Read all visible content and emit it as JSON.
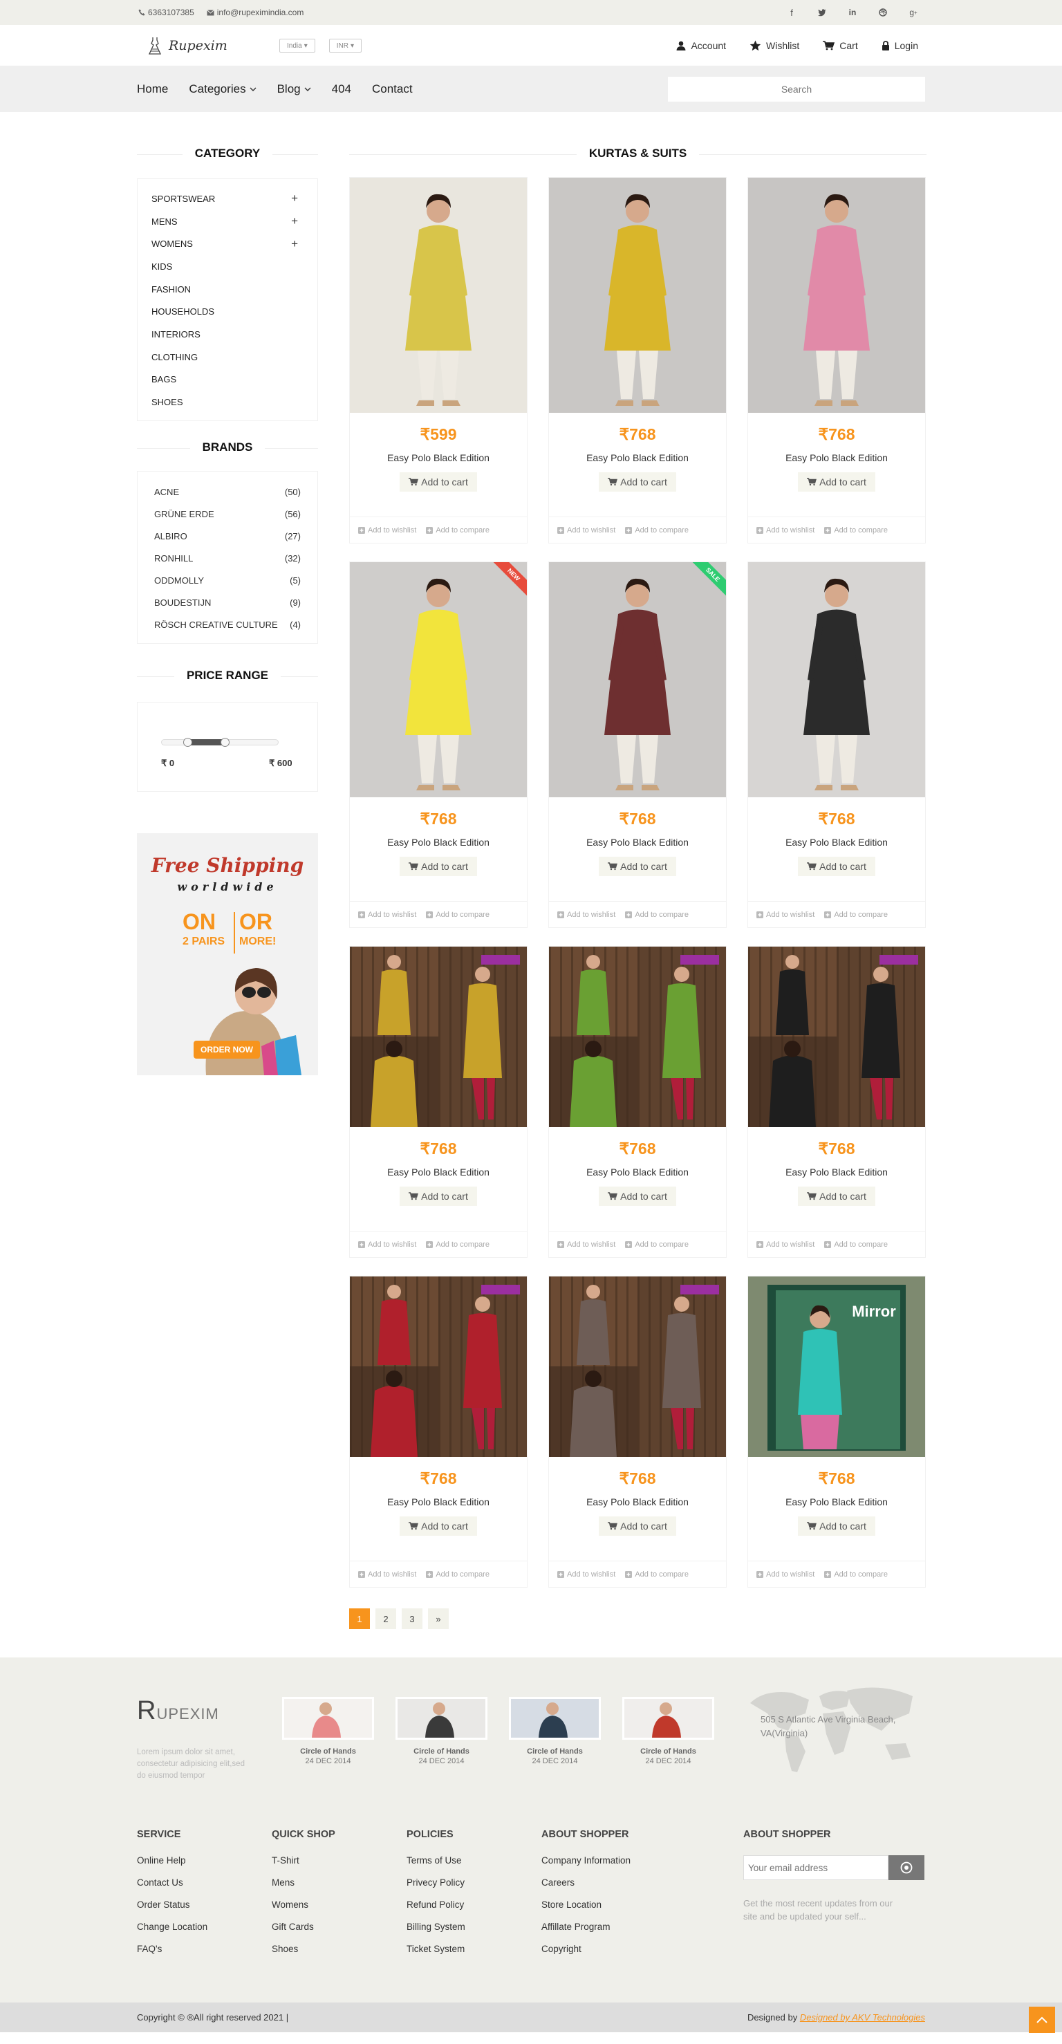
{
  "topbar": {
    "phone": "6363107385",
    "email": "info@rupeximindia.com",
    "social": [
      "facebook-icon",
      "twitter-icon",
      "linkedin-icon",
      "dribbble-icon",
      "google-plus-icon"
    ]
  },
  "header": {
    "brand": "Rupexim",
    "country": "India",
    "currency": "INR",
    "links": [
      "Account",
      "Wishlist",
      "Cart",
      "Login"
    ]
  },
  "nav": {
    "items": [
      "Home",
      "Categories",
      "Blog",
      "404",
      "Contact"
    ],
    "search_placeholder": "Search"
  },
  "sidebar": {
    "category_title": "CATEGORY",
    "categories": [
      {
        "label": "SPORTSWEAR",
        "expand": "+"
      },
      {
        "label": "MENS",
        "expand": "+"
      },
      {
        "label": "WOMENS",
        "expand": "+"
      },
      {
        "label": "KIDS",
        "expand": ""
      },
      {
        "label": "FASHION",
        "expand": ""
      },
      {
        "label": "HOUSEHOLDS",
        "expand": ""
      },
      {
        "label": "INTERIORS",
        "expand": ""
      },
      {
        "label": "CLOTHING",
        "expand": ""
      },
      {
        "label": "BAGS",
        "expand": ""
      },
      {
        "label": "SHOES",
        "expand": ""
      }
    ],
    "brands_title": "BRANDS",
    "brands": [
      {
        "label": "ACNE",
        "count": "(50)"
      },
      {
        "label": "GRÜNE ERDE",
        "count": "(56)"
      },
      {
        "label": "ALBIRO",
        "count": "(27)"
      },
      {
        "label": "RONHILL",
        "count": "(32)"
      },
      {
        "label": "ODDMOLLY",
        "count": "(5)"
      },
      {
        "label": "BOUDESTIJN",
        "count": "(9)"
      },
      {
        "label": "RÖSCH CREATIVE CULTURE",
        "count": "(4)"
      }
    ],
    "price_title": "PRICE RANGE",
    "price_min": "₹ 0",
    "price_max": "₹ 600",
    "promo": {
      "line1": "Free Shipping",
      "line2": "worldwide",
      "on": "ON",
      "or": "OR",
      "pairs": "2 PAIRS",
      "more": "MORE!",
      "cta": "ORDER NOW"
    }
  },
  "content": {
    "title": "KURTAS & SUITS",
    "add_to_cart": "Add to cart",
    "add_to_wishlist": "Add to wishlist",
    "add_to_compare": "Add to compare",
    "products": [
      {
        "price": "₹599",
        "name": "Easy Polo Black Edition",
        "color": "#d8c54a",
        "bg": "#e9e6de",
        "ribbon": ""
      },
      {
        "price": "₹768",
        "name": "Easy Polo Black Edition",
        "color": "#d9b62a",
        "bg": "#c9c7c5",
        "ribbon": ""
      },
      {
        "price": "₹768",
        "name": "Easy Polo Black Edition",
        "color": "#e18aa8",
        "bg": "#c7c5c3",
        "ribbon": ""
      },
      {
        "price": "₹768",
        "name": "Easy Polo Black Edition",
        "color": "#f2e43c",
        "bg": "#cfcdcb",
        "ribbon": "NEW"
      },
      {
        "price": "₹768",
        "name": "Easy Polo Black Edition",
        "color": "#6e2f30",
        "bg": "#cac8c6",
        "ribbon": "SALE"
      },
      {
        "price": "₹768",
        "name": "Easy Polo Black Edition",
        "color": "#2b2b2b",
        "bg": "#d7d5d3",
        "ribbon": ""
      },
      {
        "price": "₹768",
        "name": "Easy Polo Black Edition",
        "color": "#c8a22a",
        "bg": "#5a3e2a",
        "ribbon": ""
      },
      {
        "price": "₹768",
        "name": "Easy Polo Black Edition",
        "color": "#6aa033",
        "bg": "#5a3e2a",
        "ribbon": ""
      },
      {
        "price": "₹768",
        "name": "Easy Polo Black Edition",
        "color": "#1e1e1e",
        "bg": "#5a3e2a",
        "ribbon": ""
      },
      {
        "price": "₹768",
        "name": "Easy Polo Black Edition",
        "color": "#b0202c",
        "bg": "#5a3e2a",
        "ribbon": ""
      },
      {
        "price": "₹768",
        "name": "Easy Polo Black Edition",
        "color": "#6e5d56",
        "bg": "#5a3e2a",
        "ribbon": ""
      },
      {
        "price": "₹768",
        "name": "Easy Polo Black Edition",
        "color": "#2fc2b6",
        "bg": "#7e8a70",
        "ribbon": ""
      }
    ],
    "pages": [
      "1",
      "2",
      "3",
      "»"
    ]
  },
  "footer": {
    "logo_initial": "R",
    "logo_rest": "UPEXIM",
    "desc": "Lorem ipsum dolor sit amet, consectetur adipisicing elit,sed do eiusmod tempor",
    "posts": [
      {
        "title": "Circle of Hands",
        "date": "24 DEC 2014"
      },
      {
        "title": "Circle of Hands",
        "date": "24 DEC 2014"
      },
      {
        "title": "Circle of Hands",
        "date": "24 DEC 2014"
      },
      {
        "title": "Circle of Hands",
        "date": "24 DEC 2014"
      }
    ],
    "address": "505 S Atlantic Ave Virginia Beach, VA(Virginia)",
    "columns": [
      {
        "title": "SERVICE",
        "links": [
          "Online Help",
          "Contact Us",
          "Order Status",
          "Change Location",
          "FAQ's"
        ]
      },
      {
        "title": "QUICK SHOP",
        "links": [
          "T-Shirt",
          "Mens",
          "Womens",
          "Gift Cards",
          "Shoes"
        ]
      },
      {
        "title": "POLICIES",
        "links": [
          "Terms of Use",
          "Privecy Policy",
          "Refund Policy",
          "Billing System",
          "Ticket System"
        ]
      },
      {
        "title": "ABOUT SHOPPER",
        "links": [
          "Company Information",
          "Careers",
          "Store Location",
          "Affillate Program",
          "Copyright"
        ]
      }
    ],
    "newsletter_title": "ABOUT SHOPPER",
    "newsletter_placeholder": "Your email address",
    "newsletter_text": "Get the most recent updates from our site and be updated your self...",
    "copyright": "Copyright © ®All right reserved 2021 |",
    "designed_by_label": "Designed by",
    "designed_by_link": "Designed by AKV Technologies"
  }
}
